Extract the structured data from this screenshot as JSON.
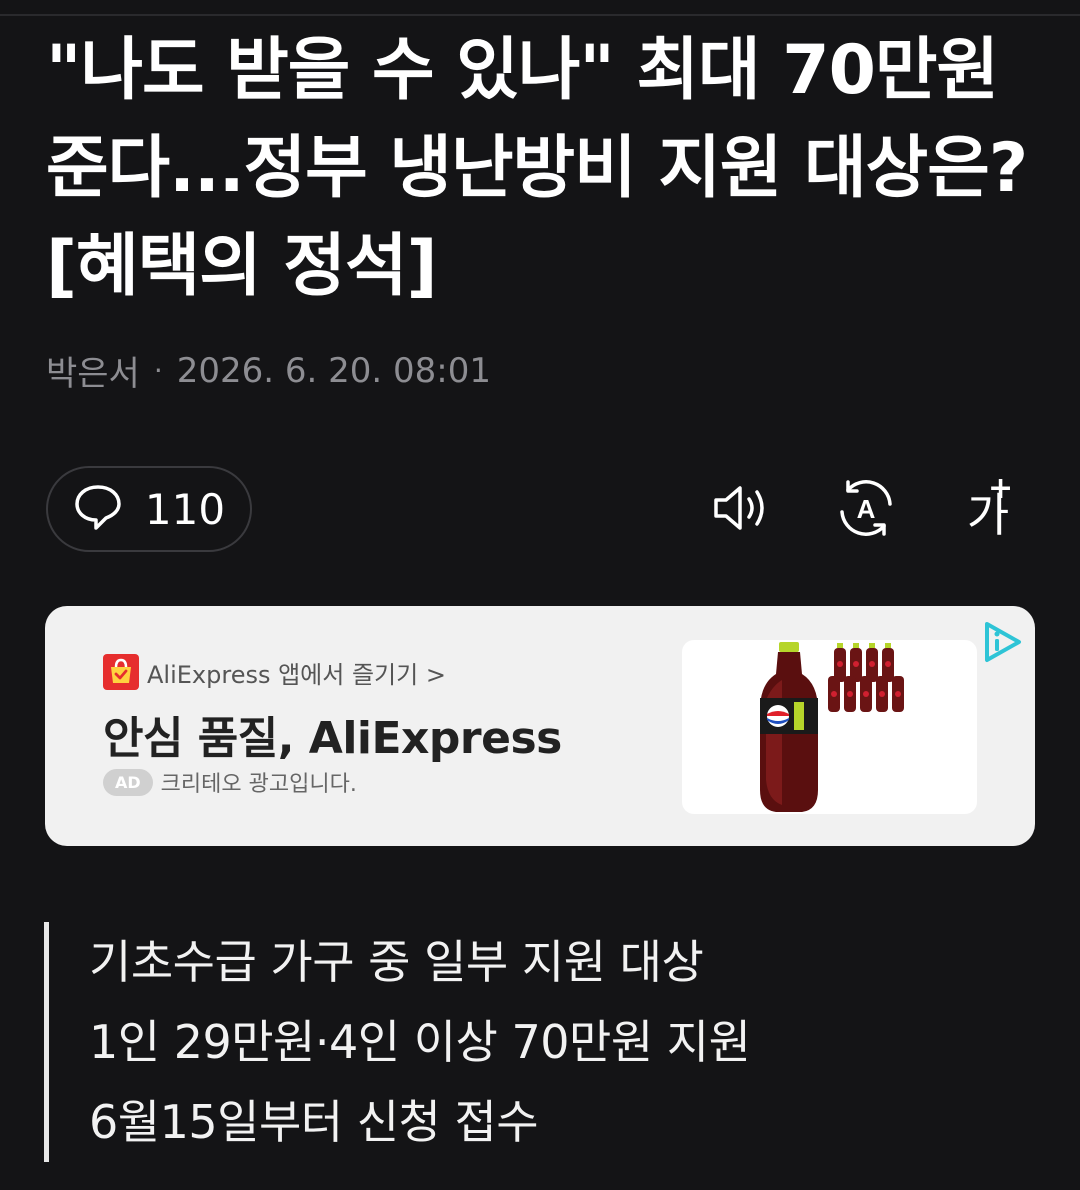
{
  "article": {
    "headline": "\"나도 받을 수 있나\" 최대 70만원 준다...정부 냉난방비 지원 대상은?[혜택의 정석]",
    "author": "박은서",
    "separator": "·",
    "timestamp": "2026. 6. 20. 08:01"
  },
  "toolbar": {
    "comment_count": "110",
    "font_size_label": "가",
    "font_size_plus": "+",
    "icons": [
      "comment-icon",
      "speaker-icon",
      "translate-icon",
      "font-size-icon"
    ]
  },
  "ad": {
    "brand_link": "AliExpress 앱에서 즐기기 >",
    "title": "안심 품질, AliExpress",
    "badge": "AD",
    "disclaimer": "크리테오 광고입니다.",
    "accent_color": "#e62e2e",
    "info_icon_color": "#2ec4d6"
  },
  "summary": {
    "lines": [
      "기초수급 가구 중 일부 지원 대상",
      "1인 29만원·4인 이상 70만원 지원",
      "6월15일부터 신청 접수"
    ]
  },
  "colors": {
    "background": "#141416",
    "headline": "#ffffff",
    "meta": "#8d8d92",
    "ad_card": "#f1f1f1"
  }
}
